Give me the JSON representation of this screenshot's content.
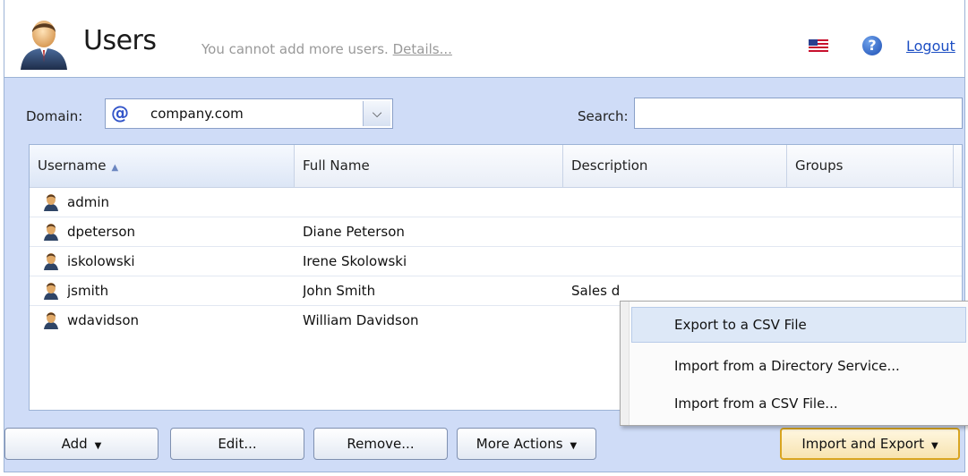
{
  "header": {
    "title": "Users",
    "notice": "You cannot add more users.",
    "details_link": "Details...",
    "logout": "Logout",
    "help_symbol": "?"
  },
  "filters": {
    "domain_label": "Domain:",
    "domain_value": "company.com",
    "search_label": "Search:",
    "search_value": ""
  },
  "table": {
    "columns": [
      "Username",
      "Full Name",
      "Description",
      "Groups"
    ],
    "sorted_column": "Username",
    "rows": [
      {
        "username": "admin",
        "full_name": "",
        "description": "",
        "groups": ""
      },
      {
        "username": "dpeterson",
        "full_name": "Diane Peterson",
        "description": "",
        "groups": ""
      },
      {
        "username": "iskolowski",
        "full_name": "Irene Skolowski",
        "description": "",
        "groups": ""
      },
      {
        "username": "jsmith",
        "full_name": "John Smith",
        "description": "Sales d",
        "groups": ""
      },
      {
        "username": "wdavidson",
        "full_name": "William Davidson",
        "description": "",
        "groups": ""
      }
    ]
  },
  "buttons": {
    "add": "Add",
    "edit": "Edit...",
    "remove": "Remove...",
    "more_actions": "More Actions",
    "import_export": "Import and Export"
  },
  "menu": {
    "items": [
      "Export to a CSV File",
      "Import from a Directory Service...",
      "Import from a CSV File..."
    ],
    "highlighted": "Export to a CSV File"
  },
  "icons": {
    "header": "users-icon",
    "flag": "us-flag-icon",
    "help": "help-icon",
    "domain": "at-sign-icon",
    "row": "user-icon"
  },
  "colors": {
    "panel_bg": "#cfdcf7",
    "link": "#1d4fc4",
    "active_button_border": "#d9a520",
    "menu_highlight": "#dde8f7"
  }
}
